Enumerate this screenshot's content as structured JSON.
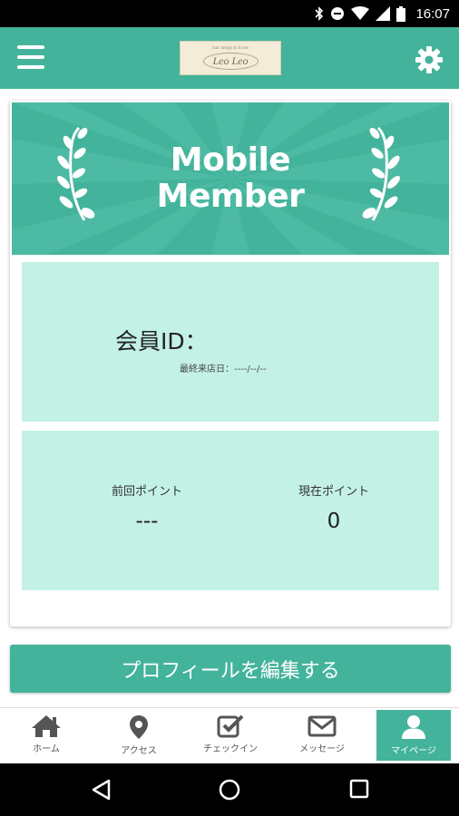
{
  "status_bar": {
    "time": "16:07",
    "icons": [
      "bluetooth-icon",
      "do-not-disturb-icon",
      "wifi-icon",
      "cellular-icon",
      "battery-icon"
    ]
  },
  "app_bar": {
    "logo_small_text": "hair design & Ecole",
    "logo_text": "Leo Leo",
    "menu_icon": "hamburger-menu-icon",
    "settings_icon": "gear-icon",
    "color": "#43b39b"
  },
  "banner": {
    "title_line1": "Mobile",
    "title_line2": "Member"
  },
  "member": {
    "id_label": "会員ID：",
    "last_visit": "最終来店日：----/--/--"
  },
  "points": {
    "previous_label": "前回ポイント",
    "previous_value": "---",
    "current_label": "現在ポイント",
    "current_value": "0"
  },
  "edit_profile_label": "プロフィールを編集する",
  "bottom_nav": [
    {
      "label": "ホーム",
      "icon": "home-icon"
    },
    {
      "label": "アクセス",
      "icon": "map-pin-icon"
    },
    {
      "label": "チェックイン",
      "icon": "checkbox-icon"
    },
    {
      "label": "メッセージ",
      "icon": "mail-icon"
    },
    {
      "label": "マイページ",
      "icon": "user-icon",
      "active": true
    }
  ],
  "system_nav": [
    "back-icon",
    "home-circle-icon",
    "recents-icon"
  ],
  "colors": {
    "accent": "#43b39b",
    "panel": "#c3f1e6"
  }
}
